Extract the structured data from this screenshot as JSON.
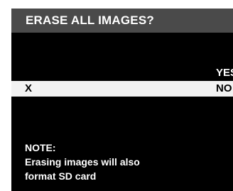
{
  "dialog": {
    "title": "ERASE ALL IMAGES?",
    "options": {
      "yes_label": "YES",
      "no_label": "NO",
      "cursor_mark": "X"
    },
    "note": {
      "heading": "NOTE:",
      "line1": "Erasing images will also",
      "line2": "format SD card"
    }
  },
  "colors": {
    "background": "#000000",
    "title_bar": "#4a4a4a",
    "selected_row": "#f2f2f2",
    "text": "#ffffff",
    "selected_text": "#000000"
  }
}
